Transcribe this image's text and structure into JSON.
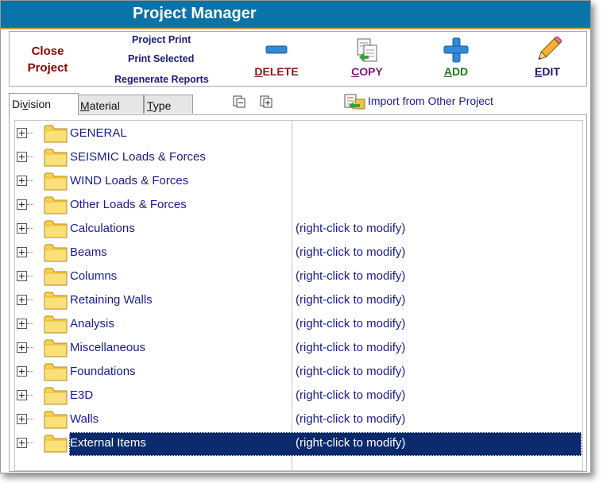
{
  "window": {
    "title": "Project Manager"
  },
  "toolbar": {
    "close_label_1": "Close",
    "close_label_2": "Project",
    "project_print": "Project Print",
    "print_selected": "Print Selected",
    "regenerate_reports": "Regenerate Reports",
    "delete": {
      "first": "D",
      "rest": "ELETE",
      "color": "#8b1a1a"
    },
    "copy": {
      "first": "C",
      "rest": "OPY",
      "color": "#7a1a7a"
    },
    "add": {
      "first": "A",
      "rest": "DD",
      "color": "#1a7a1a"
    },
    "edit": {
      "first": "E",
      "rest": "DIT",
      "color": "#1a1a6a"
    }
  },
  "tabs": [
    {
      "first": "Di",
      "u": "v",
      "rest": "ision",
      "active": true
    },
    {
      "first": "",
      "u": "M",
      "rest": "aterial",
      "active": false
    },
    {
      "first": "",
      "u": "T",
      "rest": "ype",
      "active": false
    }
  ],
  "import_label": "Import from Other Project",
  "items": [
    {
      "name": "GENERAL",
      "note": ""
    },
    {
      "name": "SEISMIC Loads & Forces",
      "note": ""
    },
    {
      "name": "WIND Loads & Forces",
      "note": ""
    },
    {
      "name": "Other Loads & Forces",
      "note": ""
    },
    {
      "name": "Calculations",
      "note": "(right-click to modify)"
    },
    {
      "name": "Beams",
      "note": "(right-click to modify)"
    },
    {
      "name": "Columns",
      "note": "(right-click to modify)"
    },
    {
      "name": "Retaining Walls",
      "note": "(right-click to modify)"
    },
    {
      "name": "Analysis",
      "note": "(right-click to modify)"
    },
    {
      "name": "Miscellaneous",
      "note": "(right-click to modify)"
    },
    {
      "name": "Foundations",
      "note": "(right-click to modify)"
    },
    {
      "name": "E3D",
      "note": "(right-click to modify)"
    },
    {
      "name": "Walls",
      "note": "(right-click to modify)"
    },
    {
      "name": "External Items",
      "note": "(right-click to modify)",
      "selected": true
    }
  ]
}
